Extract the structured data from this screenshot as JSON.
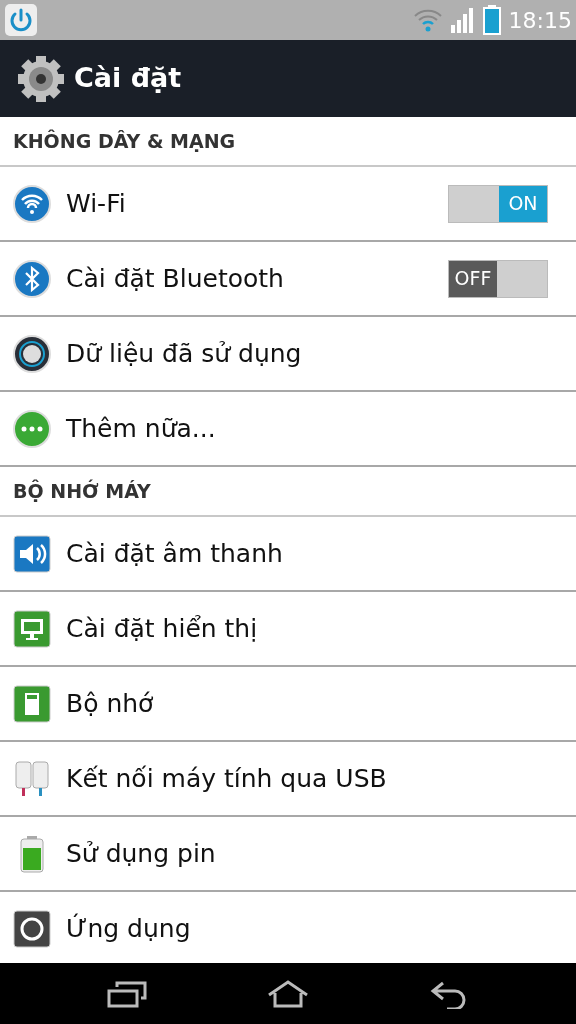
{
  "status_bar": {
    "time": "18:15"
  },
  "action_bar": {
    "title": "Cài đặt"
  },
  "sections": [
    {
      "header": "KHÔNG DÂY & MẠNG",
      "items": [
        {
          "label": "Wi-Fi",
          "toggle": {
            "on": true,
            "label": "ON"
          }
        },
        {
          "label": "Cài đặt Bluetooth",
          "toggle": {
            "on": false,
            "label": "OFF"
          }
        },
        {
          "label": "Dữ liệu đã sử dụng"
        },
        {
          "label": "Thêm nữa..."
        }
      ]
    },
    {
      "header": "BỘ NHỚ MÁY",
      "items": [
        {
          "label": "Cài đặt âm thanh"
        },
        {
          "label": "Cài đặt hiển thị"
        },
        {
          "label": "Bộ nhớ"
        },
        {
          "label": "Kết nối máy tính qua USB"
        },
        {
          "label": "Sử dụng pin"
        },
        {
          "label": "Ứng dụng"
        }
      ]
    }
  ]
}
